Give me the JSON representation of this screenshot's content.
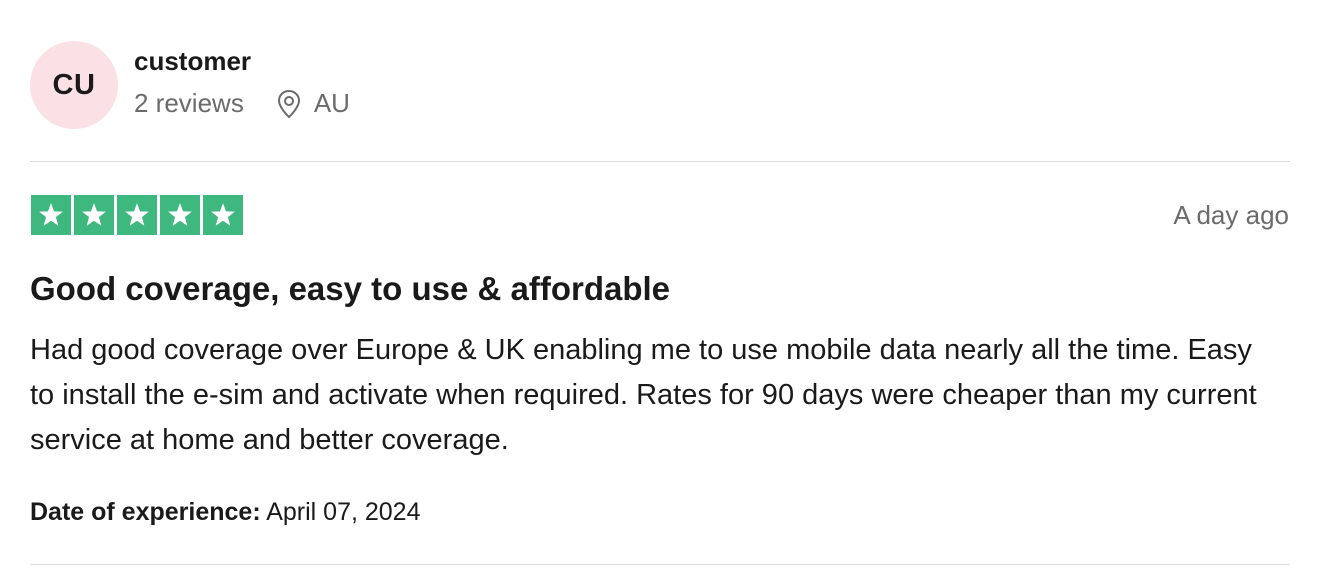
{
  "consumer": {
    "initials": "CU",
    "name": "customer",
    "reviews_count": "2 reviews",
    "location": "AU"
  },
  "review": {
    "rating": 5,
    "rating_max": 5,
    "date": "A day ago",
    "title": "Good coverage, easy to use & affordable",
    "body": "Had good coverage over Europe & UK enabling me to use mobile data nearly all the time. Easy to install the e-sim and activate when required. Rates for 90 days were cheaper than my current service at home and better coverage.",
    "experience_label": "Date of experience:",
    "experience_date": "April 07, 2024"
  },
  "icons": {
    "location": "location-pin-icon",
    "star": "star-icon"
  },
  "colors": {
    "star_background": "#3fb87f",
    "avatar_background": "#fbe0e6",
    "muted_text": "#6b6b6b"
  }
}
